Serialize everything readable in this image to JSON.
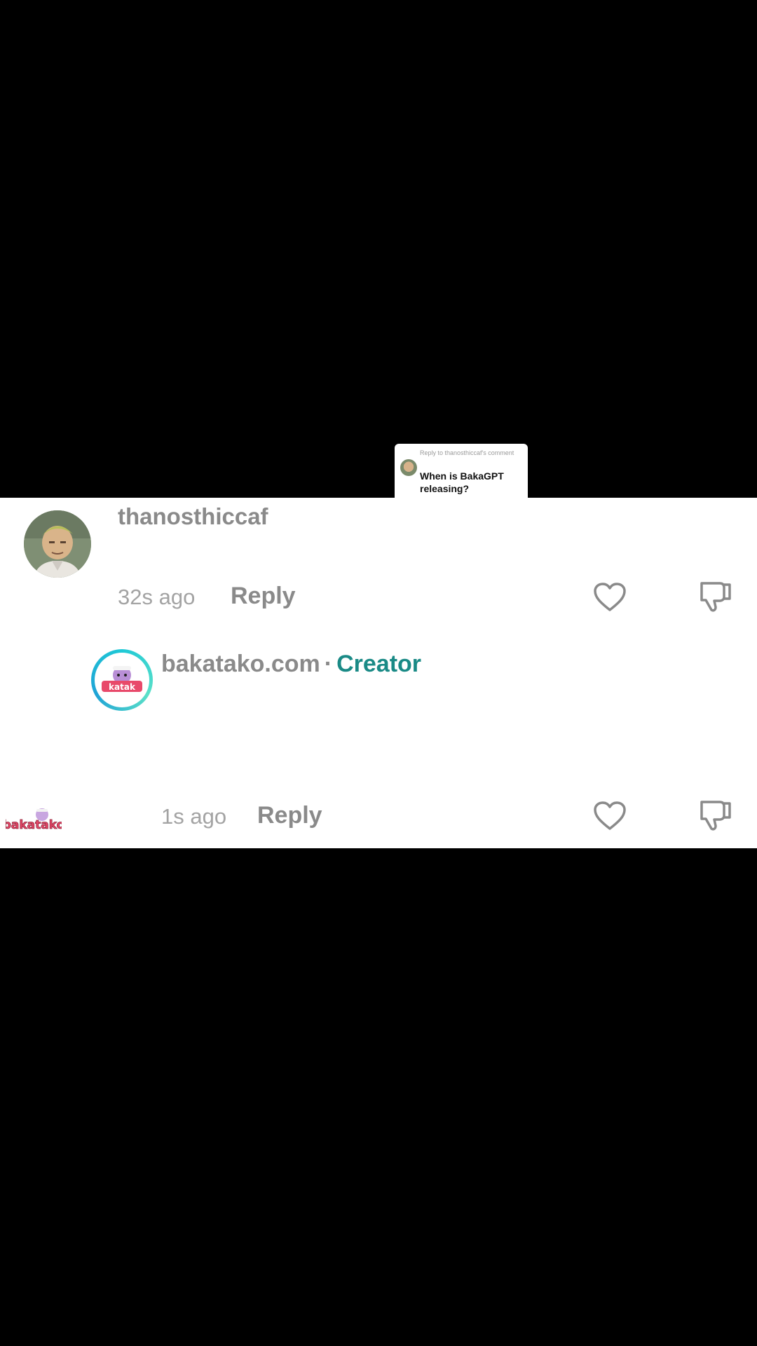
{
  "reply_bubble": {
    "caption": "Reply to thanosthiccaf's comment",
    "question": "When is BakaGPT releasing?"
  },
  "comment": {
    "username": "thanosthiccaf",
    "time": "32s ago",
    "reply_label": "Reply"
  },
  "reply": {
    "username": "bakatako.com",
    "separator": "·",
    "badge": "Creator",
    "time": "1s ago",
    "reply_label": "Reply"
  },
  "watermark": {
    "text": "bakatako"
  },
  "colors": {
    "creator_badge": "#1a8a86",
    "avatar_ring": "#1fc9d6",
    "icon_gray": "#8a8a8a"
  }
}
